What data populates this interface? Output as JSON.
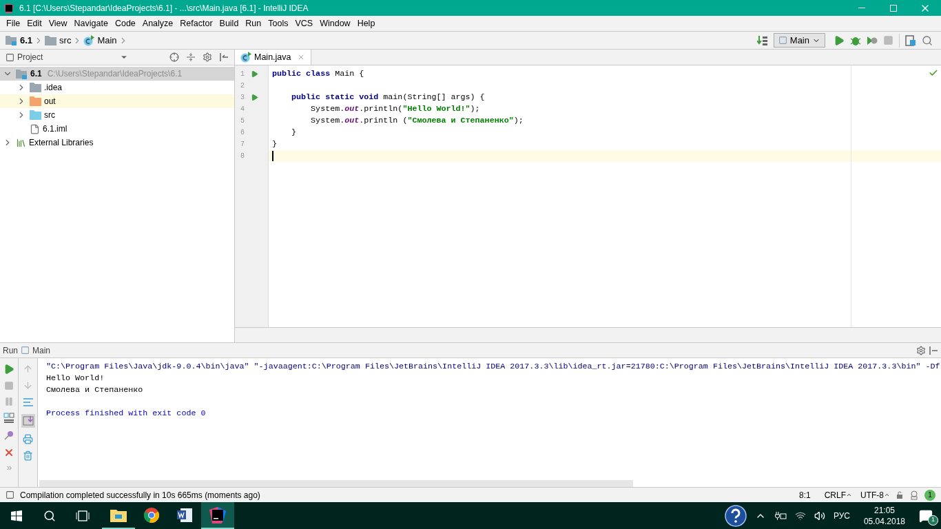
{
  "window": {
    "title": "6.1 [C:\\Users\\Stepandar\\IdeaProjects\\6.1] - ...\\src\\Main.java [6.1] - IntelliJ IDEA"
  },
  "menu": [
    "File",
    "Edit",
    "View",
    "Navigate",
    "Code",
    "Analyze",
    "Refactor",
    "Build",
    "Run",
    "Tools",
    "VCS",
    "Window",
    "Help"
  ],
  "breadcrumbs": [
    {
      "kind": "module",
      "label": "6.1"
    },
    {
      "kind": "folder",
      "label": "src"
    },
    {
      "kind": "class",
      "label": "Main"
    }
  ],
  "run_config": {
    "label": "Main"
  },
  "project_panel": {
    "title": "Project",
    "tree": [
      {
        "kind": "module",
        "label": "6.1",
        "path": "C:\\Users\\Stepandar\\IdeaProjects\\6.1",
        "expanded": true,
        "selected": true,
        "children": [
          {
            "kind": "folder",
            "label": ".idea",
            "expanded": false,
            "selected": false
          },
          {
            "kind": "excluded",
            "label": "out",
            "expanded": false,
            "selected": false
          },
          {
            "kind": "source",
            "label": "src",
            "expanded": false,
            "selected": false
          },
          {
            "kind": "file",
            "label": "6.1.iml",
            "selected": false
          }
        ]
      },
      {
        "kind": "library",
        "label": "External Libraries",
        "expanded": false,
        "selected": false
      }
    ]
  },
  "editor": {
    "tabs": [
      {
        "label": "Main.java",
        "selected": true
      }
    ],
    "lines": [
      {
        "number": "1",
        "run_marker": true,
        "current": false,
        "tokens": [
          {
            "kind": "keyword",
            "text": "public class "
          },
          {
            "kind": "plain",
            "text": "Main {"
          }
        ]
      },
      {
        "number": "2",
        "run_marker": false,
        "current": false
      },
      {
        "number": "3",
        "run_marker": true,
        "current": false,
        "tokens": [
          {
            "kind": "keyword",
            "text": "    public static void "
          },
          {
            "kind": "plain",
            "text": "main(String[] args) {"
          }
        ]
      },
      {
        "number": "4",
        "run_marker": false,
        "current": false,
        "tokens": [
          {
            "kind": "plain",
            "text": "        System."
          },
          {
            "kind": "field",
            "text": "out"
          },
          {
            "kind": "plain",
            "text": ".println("
          },
          {
            "kind": "string",
            "text": "\"Hello World!\""
          },
          {
            "kind": "plain",
            "text": ");"
          }
        ]
      },
      {
        "number": "5",
        "run_marker": false,
        "current": false,
        "tokens": [
          {
            "kind": "plain",
            "text": "        System."
          },
          {
            "kind": "field",
            "text": "out"
          },
          {
            "kind": "plain",
            "text": ".println ("
          },
          {
            "kind": "string",
            "text": "\"Смолева и Степаненко\""
          },
          {
            "kind": "plain",
            "text": ");"
          }
        ]
      },
      {
        "number": "6",
        "run_marker": false,
        "current": false,
        "tokens": [
          {
            "kind": "plain",
            "text": "    }"
          }
        ]
      },
      {
        "number": "7",
        "run_marker": false,
        "current": false,
        "tokens": [
          {
            "kind": "plain",
            "text": "}"
          }
        ]
      },
      {
        "number": "8",
        "run_marker": false,
        "current": true
      }
    ]
  },
  "run_panel": {
    "title": "Run",
    "config": "Main",
    "console": [
      {
        "kind": "command",
        "text": "\"C:\\Program Files\\Java\\jdk-9.0.4\\bin\\java\" \"-javaagent:C:\\Program Files\\JetBrains\\IntelliJ IDEA 2017.3.3\\lib\\idea_rt.jar=21780:C:\\Program Files\\JetBrains\\IntelliJ IDEA 2017.3.3\\bin\" -Df"
      },
      {
        "kind": "output",
        "text": "Hello World!"
      },
      {
        "kind": "output",
        "text": "Смолева и Степаненко"
      },
      {
        "kind": "exit",
        "text": "Process finished with exit code 0"
      }
    ]
  },
  "status_bar": {
    "message": "Compilation completed successfully in 10s 665ms (moments ago)",
    "position": "8:1",
    "line_separator": "CRLF",
    "encoding": "UTF-8",
    "notifications": "1"
  },
  "taskbar": {
    "apps": [
      {
        "kind": "explorer",
        "running": true,
        "selected": false
      },
      {
        "kind": "chrome",
        "running": false,
        "selected": false
      },
      {
        "kind": "word",
        "running": false,
        "selected": false
      },
      {
        "kind": "intellij",
        "running": true,
        "selected": true
      }
    ],
    "language": "РУС",
    "time": "21:05",
    "date": "05.04.2018",
    "notifications": "1"
  }
}
